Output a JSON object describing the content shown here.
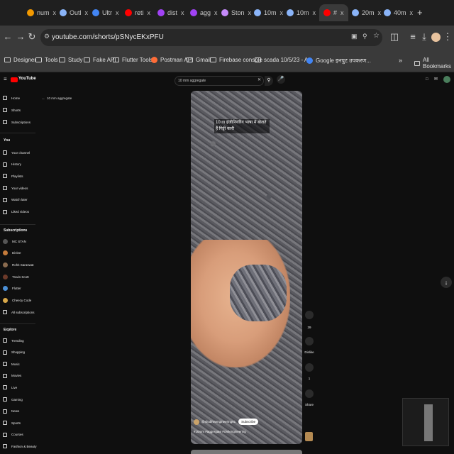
{
  "tabs": [
    {
      "label": "num",
      "color": "#f29900"
    },
    {
      "label": "Outl",
      "color": "#8ab4f8"
    },
    {
      "label": "Ultr",
      "color": "#4285f4"
    },
    {
      "label": "reti",
      "color": "#ff0000"
    },
    {
      "label": "dist",
      "color": "#a142f4"
    },
    {
      "label": "agg",
      "color": "#a142f4"
    },
    {
      "label": "Ston",
      "color": "#c58af9"
    },
    {
      "label": "10m",
      "color": "#8ab4f8"
    },
    {
      "label": "10m",
      "color": "#8ab4f8"
    },
    {
      "label": "#",
      "color": "#ff0000"
    },
    {
      "label": "20m",
      "color": "#8ab4f8"
    },
    {
      "label": "40m",
      "color": "#8ab4f8"
    }
  ],
  "tab_close": "x",
  "new_tab": "+",
  "address": {
    "url": "youtube.com/shorts/pSNycEKxPFU"
  },
  "bookmarks": [
    {
      "label": "Designer",
      "kind": "folder"
    },
    {
      "label": "Tools",
      "kind": "folder"
    },
    {
      "label": "Study",
      "kind": "folder"
    },
    {
      "label": "Fake API",
      "kind": "folder"
    },
    {
      "label": "Flutter Tools",
      "kind": "folder"
    },
    {
      "label": "Postman API",
      "kind": "site",
      "color": "#ff6c37"
    },
    {
      "label": "Gmail",
      "kind": "folder"
    },
    {
      "label": "Firebase console",
      "kind": "folder"
    },
    {
      "label": "scada 10/5/23 - A...",
      "kind": "folder"
    },
    {
      "label": "Google इनपुट उपकरण...",
      "kind": "site",
      "color": "#4285f4"
    }
  ],
  "all_bookmarks": "All Bookmarks",
  "youtube": {
    "logo": "YouTube",
    "search_value": "10 mm aggregate",
    "back_label": "10 mm aggregate",
    "sidebar": {
      "main": [
        "Home",
        "Shorts",
        "Subscriptions"
      ],
      "you_heading": "You",
      "you": [
        "Your channel",
        "History",
        "Playlists",
        "Your videos",
        "Watch later",
        "Liked videos"
      ],
      "subs_heading": "Subscriptions",
      "subs": [
        "MC STAN",
        "Divine",
        "Rohit Saraswat",
        "Travis Scott",
        "Flutter",
        "Cheezy Code",
        "All subscriptions"
      ],
      "explore_heading": "Explore",
      "explore": [
        "Trending",
        "Shopping",
        "Music",
        "Movies",
        "Live",
        "Gaming",
        "News",
        "Sports",
        "Courses",
        "Fashion & Beauty"
      ]
    },
    "video": {
      "caption": "10 m इंजीनियरिंग भाषा में बोलते हैं गिट्टी कारी",
      "channel": "@shubhrtengineering91",
      "subscribe": "Subscribe",
      "hashtags": "#10mm #aggregate #civilengineering"
    },
    "actions": {
      "likes": "39",
      "dislike": "Dislike",
      "comments": "1",
      "share": "Share"
    }
  }
}
